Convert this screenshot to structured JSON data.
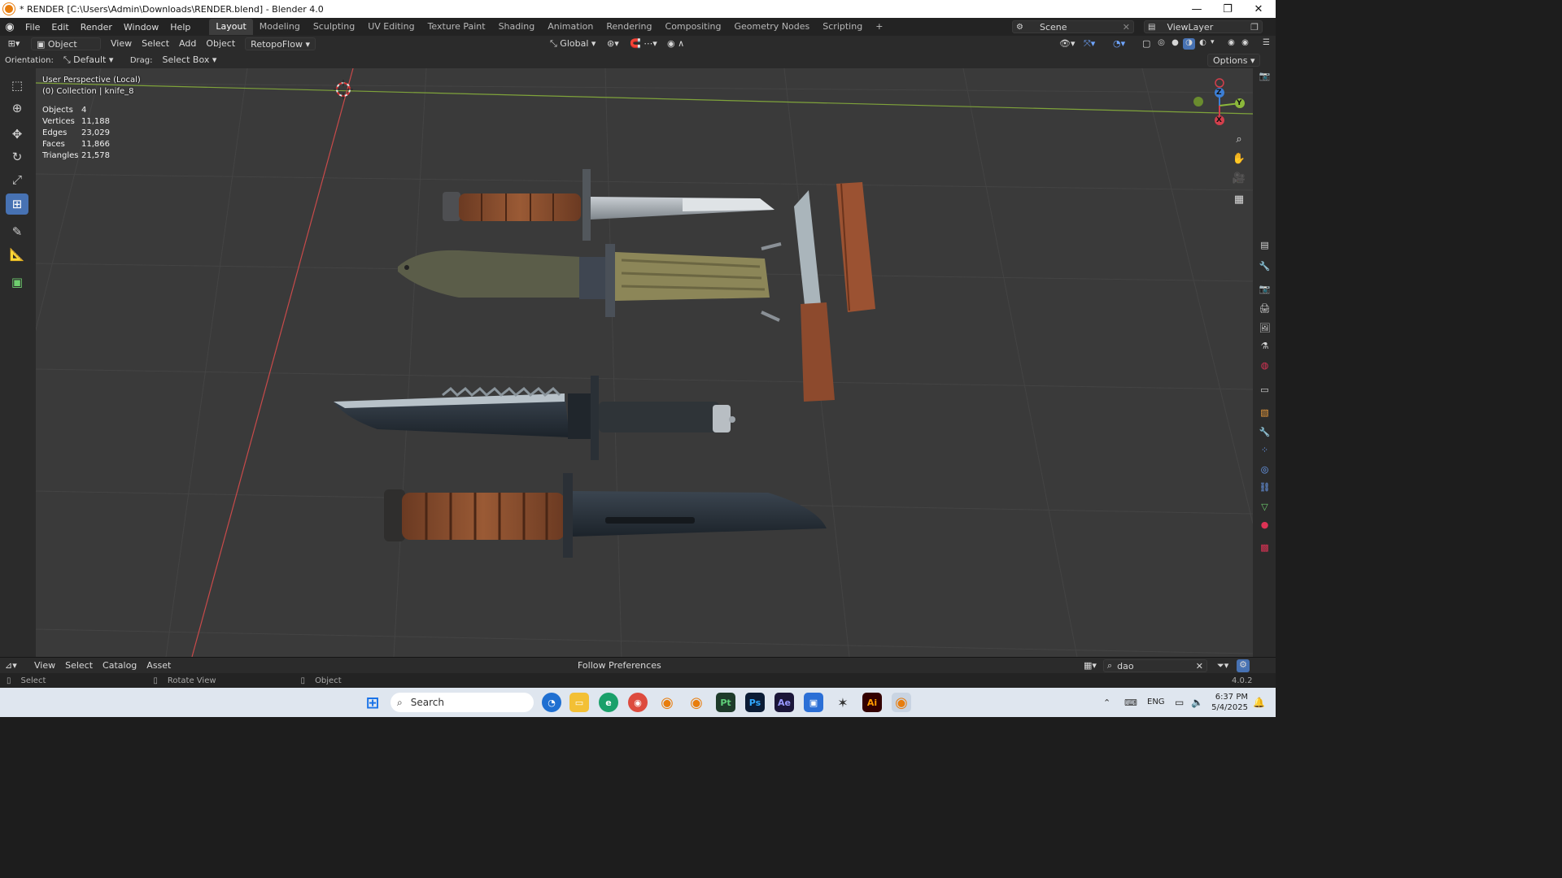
{
  "window": {
    "title": "* RENDER [C:\\Users\\Admin\\Downloads\\RENDER.blend] - Blender 4.0",
    "controls": [
      "—",
      "❐",
      "✕"
    ]
  },
  "menubar": {
    "menus": [
      "File",
      "Edit",
      "Render",
      "Window",
      "Help"
    ],
    "workspaces": [
      "Layout",
      "Modeling",
      "Sculpting",
      "UV Editing",
      "Texture Paint",
      "Shading",
      "Animation",
      "Rendering",
      "Compositing",
      "Geometry Nodes",
      "Scripting"
    ],
    "active_workspace": "Layout",
    "add_tab": "+",
    "scene": "Scene",
    "view_layer": "ViewLayer"
  },
  "header": {
    "mode": "Object Mode",
    "menus": [
      "View",
      "Select",
      "Add",
      "Object"
    ],
    "addon": "RetopoFlow",
    "transform_orientation": "Global",
    "options": "Options"
  },
  "toolsettings": {
    "orientation_label": "Orientation:",
    "orientation_value": "Default",
    "drag_label": "Drag:",
    "drag_value": "Select Box"
  },
  "viewport": {
    "view_name": "User Perspective (Local)",
    "collection": "(0) Collection | knife_8",
    "stats": [
      {
        "label": "Objects",
        "value": "4"
      },
      {
        "label": "Vertices",
        "value": "11,188"
      },
      {
        "label": "Edges",
        "value": "23,029"
      },
      {
        "label": "Faces",
        "value": "11,866"
      },
      {
        "label": "Triangles",
        "value": "21,578"
      }
    ],
    "gizmo": {
      "x": "X",
      "y": "Y",
      "z": "Z"
    },
    "colors": {
      "x_axis": "#d33f4c",
      "y_axis": "#8cb83b",
      "z_axis": "#3c7fd6",
      "active": "#4772b3",
      "bg": "#3a3a3a"
    }
  },
  "assetbar": {
    "menus": [
      "View",
      "Select",
      "Catalog",
      "Asset"
    ],
    "import_method": "Follow Preferences",
    "search_value": "dao"
  },
  "statusbar": {
    "select": "Select",
    "rotate": "Rotate View",
    "object": "Object",
    "version": "4.0.2"
  },
  "taskbar": {
    "search_placeholder": "Search",
    "language": "ENG",
    "time": "6:37 PM",
    "date": "5/4/2025",
    "apps": [
      "Pt",
      "Ps",
      "Ae",
      "Ai"
    ]
  }
}
